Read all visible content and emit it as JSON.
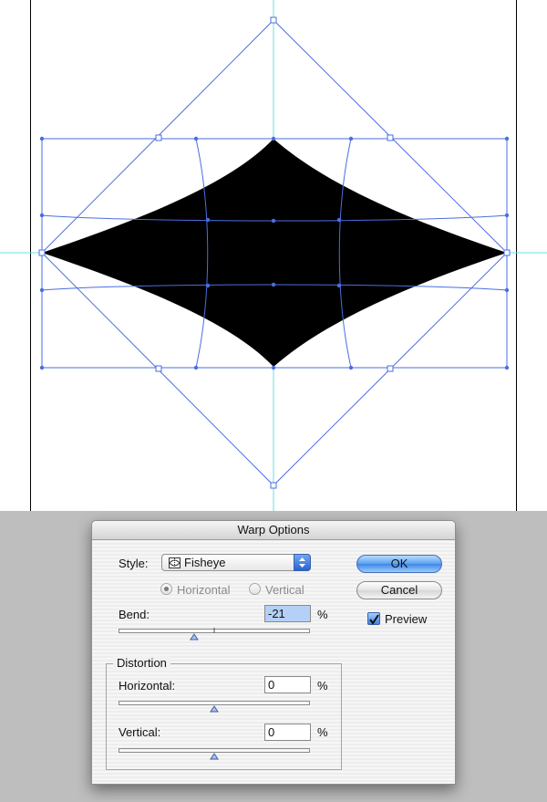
{
  "dialog": {
    "title": "Warp Options",
    "style_label": "Style:",
    "style_value": "Fisheye",
    "orientation": {
      "horizontal_label": "Horizontal",
      "vertical_label": "Vertical",
      "selected": "horizontal",
      "enabled": false
    },
    "bend": {
      "label": "Bend:",
      "value": "-21",
      "unit": "%",
      "slider_percent": -21
    },
    "distortion": {
      "group_label": "Distortion",
      "horizontal": {
        "label": "Horizontal:",
        "value": "0",
        "unit": "%",
        "slider_percent": 0
      },
      "vertical": {
        "label": "Vertical:",
        "value": "0",
        "unit": "%",
        "slider_percent": 0
      }
    },
    "buttons": {
      "ok_label": "OK",
      "cancel_label": "Cancel"
    },
    "preview": {
      "label": "Preview",
      "checked": true
    }
  },
  "colors": {
    "guide": "#66e0e0",
    "mesh": "#4a6ee0",
    "shape": "#000000",
    "desk": "#bebebe"
  }
}
